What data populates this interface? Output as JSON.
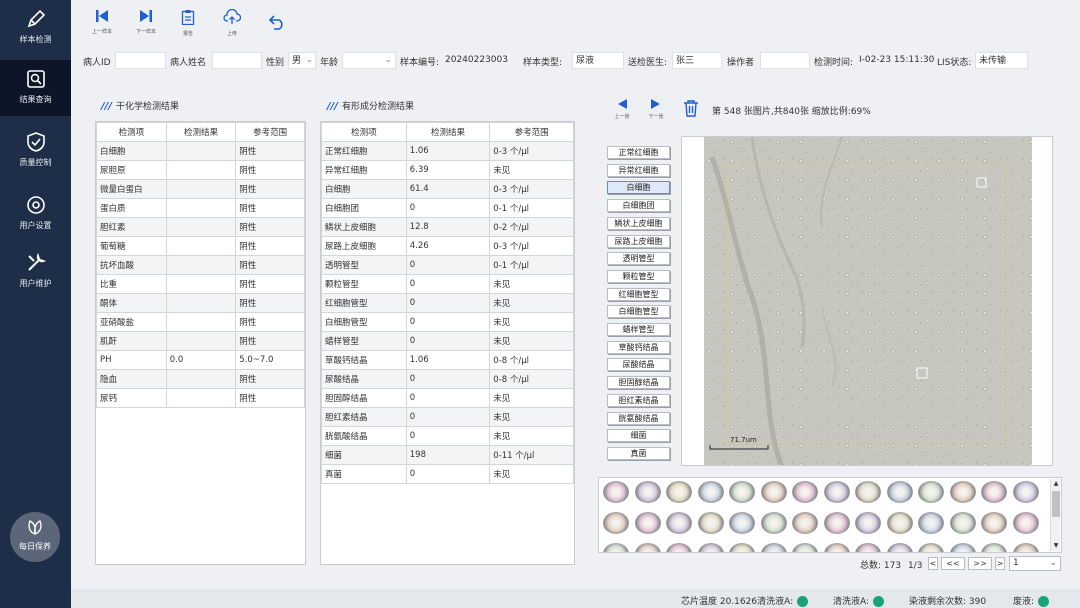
{
  "nav": {
    "sample_detect": "样本检测",
    "result_query": "结果查询",
    "quality_control": "质量控制",
    "user_settings": "用户设置",
    "user_maintenance": "用户维护",
    "daily_maintenance": "每日保养"
  },
  "toolbar": {
    "prev_sample": "上一样本",
    "next_sample": "下一样本",
    "report": "报告",
    "upload": "上传"
  },
  "form": {
    "patient_id_label": "病人ID",
    "patient_id_value": "",
    "patient_name_label": "病人姓名",
    "patient_name_value": "",
    "gender_label": "性别",
    "gender_value": "男",
    "age_label": "年龄",
    "age_value": "",
    "sample_no_label": "样本编号:",
    "sample_no_value": "20240223003",
    "sample_type_label": "样本类型:",
    "sample_type_value": "尿液",
    "doctor_label": "送检医生:",
    "doctor_value": "张三",
    "operator_label": "操作者",
    "operator_value": "",
    "test_time_label": "检测时间:",
    "test_time_value": "I-02-23 15:11:30",
    "lis_label": "LIS状态:",
    "lis_value": "未传输"
  },
  "dry_chem": {
    "title": "干化学检测结果",
    "headers": [
      "检测项",
      "检测结果",
      "参考范围"
    ],
    "rows": [
      {
        "item": "白细胞",
        "result": "",
        "ref": "阴性"
      },
      {
        "item": "尿胆原",
        "result": "",
        "ref": "阴性"
      },
      {
        "item": "微量白蛋白",
        "result": "",
        "ref": "阴性"
      },
      {
        "item": "蛋白质",
        "result": "",
        "ref": "阴性"
      },
      {
        "item": "胆红素",
        "result": "",
        "ref": "阴性"
      },
      {
        "item": "葡萄糖",
        "result": "",
        "ref": "阴性"
      },
      {
        "item": "抗坏血酸",
        "result": "",
        "ref": "阴性"
      },
      {
        "item": "比重",
        "result": "",
        "ref": "阴性"
      },
      {
        "item": "酮体",
        "result": "",
        "ref": "阴性"
      },
      {
        "item": "亚硝酸盐",
        "result": "",
        "ref": "阴性"
      },
      {
        "item": "肌酐",
        "result": "",
        "ref": "阴性"
      },
      {
        "item": "PH",
        "result": "0.0",
        "ref": "5.0~7.0",
        "abnormal": true
      },
      {
        "item": "隐血",
        "result": "",
        "ref": "阴性"
      },
      {
        "item": "尿钙",
        "result": "",
        "ref": "阴性"
      }
    ]
  },
  "formed": {
    "title": "有形成分检测结果",
    "headers": [
      "检测项",
      "检测结果",
      "参考范围"
    ],
    "rows": [
      {
        "item": "正常红细胞",
        "result": "1.06",
        "ref": "0-3 个/μl"
      },
      {
        "item": "异常红细胞",
        "result": "6.39",
        "ref": "未见",
        "abnormal": true
      },
      {
        "item": "白细胞",
        "result": "61.4",
        "ref": "0-3 个/μl",
        "abnormal": true
      },
      {
        "item": "白细胞团",
        "result": "0",
        "ref": "0-1 个/μl"
      },
      {
        "item": "鳞状上皮细胞",
        "result": "12.8",
        "ref": "0-2 个/μl",
        "abnormal": true
      },
      {
        "item": "尿路上皮细胞",
        "result": "4.26",
        "ref": "0-3 个/μl",
        "abnormal": true
      },
      {
        "item": "透明管型",
        "result": "0",
        "ref": "0-1 个/μl"
      },
      {
        "item": "颗粒管型",
        "result": "0",
        "ref": "未见"
      },
      {
        "item": "红细胞管型",
        "result": "0",
        "ref": "未见"
      },
      {
        "item": "白细胞管型",
        "result": "0",
        "ref": "未见"
      },
      {
        "item": "蜡样管型",
        "result": "0",
        "ref": "未见"
      },
      {
        "item": "草酸钙结晶",
        "result": "1.06",
        "ref": "0-8 个/μl"
      },
      {
        "item": "尿酸结晶",
        "result": "0",
        "ref": "0-8 个/μl"
      },
      {
        "item": "胆固醇结晶",
        "result": "0",
        "ref": "未见"
      },
      {
        "item": "胆红素结晶",
        "result": "0",
        "ref": "未见"
      },
      {
        "item": "胱氨酸结晶",
        "result": "0",
        "ref": "未见"
      },
      {
        "item": "细菌",
        "result": "198",
        "ref": "0-11 个/μl",
        "abnormal": true
      },
      {
        "item": "真菌",
        "result": "0",
        "ref": "未见"
      }
    ]
  },
  "viewer": {
    "prev_label": "上一张",
    "next_label": "下一张",
    "info": "第 548 张图片,共840张 缩放比例:69%",
    "scale_label": "71.7um",
    "categories": [
      "正常红细胞",
      "异常红细胞",
      "白细胞",
      "白细胞团",
      "鳞状上皮细胞",
      "尿路上皮细胞",
      "透明管型",
      "颗粒管型",
      "红细胞管型",
      "白细胞管型",
      "蜡样管型",
      "草酸钙结晶",
      "尿酸结晶",
      "胆固醇结晶",
      "胆红素结晶",
      "胱氨酸结晶",
      "细菌",
      "真菌"
    ],
    "selected_category": "白细胞"
  },
  "thumbs": {
    "total_label": "总数: 173",
    "page": "1/3",
    "first": "<",
    "prev": "<<",
    "next": ">>",
    "last": ">",
    "page_select": "1"
  },
  "status": {
    "chip_temp": "芯片温度 20.1626清洗液A:",
    "clean_a": "清洗液A:",
    "dye_remaining": "染液剩余次数: 390",
    "waste": "废液:"
  },
  "colors": {
    "accent": "#1f5fd0",
    "sidebar": "#1f2e48",
    "abnormal": "#e02020",
    "ok_dot": "#1aa37a"
  }
}
